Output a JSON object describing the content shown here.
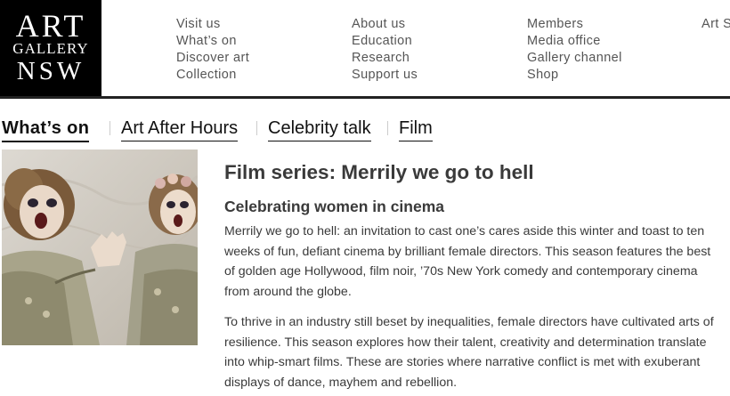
{
  "logo": {
    "line1": "ART",
    "line2": "GALLERY",
    "line3": "NSW"
  },
  "nav": {
    "col1": [
      "Visit us",
      "What’s on",
      "Discover art",
      "Collection"
    ],
    "col2": [
      "About us",
      "Education",
      "Research",
      "Support us"
    ],
    "col3": [
      "Members",
      "Media office",
      "Gallery channel",
      "Shop"
    ],
    "col4": [
      "Art S"
    ]
  },
  "subnav": {
    "active": "What’s on",
    "items": [
      "Art After Hours",
      "Celebrity talk",
      "Film"
    ]
  },
  "article": {
    "title": "Film series: Merrily we go to hell",
    "subtitle": "Celebrating women in cinema",
    "para1": "Merrily we go to hell: an invitation to cast one’s cares aside this winter and toast to ten weeks of fun, defiant cinema by brilliant female directors. This season features the best of golden age Hollywood, film noir, ’70s New York comedy and contemporary cinema from around the globe.",
    "para2": "To thrive in an industry still beset by inequalities, female directors have cultivated arts of resilience. This season explores how their talent, creativity and determination translate into whip-smart films. These are stories where narrative conflict is met with exuberant displays of dance, mayhem and rebellion."
  }
}
